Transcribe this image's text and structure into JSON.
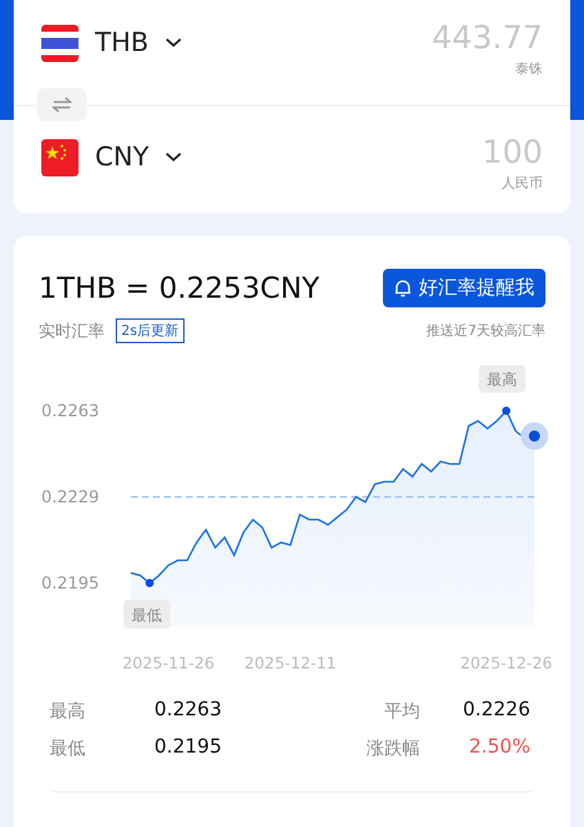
{
  "converter": {
    "rows": [
      {
        "code": "THB",
        "kind": "thailand",
        "amount": "443.77",
        "currency_name": "泰铢"
      },
      {
        "code": "CNY",
        "kind": "china",
        "amount": "100",
        "currency_name": "人民币"
      }
    ]
  },
  "rate": {
    "headline": "1THB = 0.2253CNY",
    "alert_button": "好汇率提醒我",
    "label": "实时汇率",
    "update_badge": "2s后更新",
    "push_note": "推送近7天较高汇率"
  },
  "chart_data": {
    "type": "area",
    "ylim": [
      0.2195,
      0.2263
    ],
    "yticks": [
      0.2195,
      0.2229,
      0.2263
    ],
    "categories": [
      null,
      null,
      null,
      null,
      "2025-11-26",
      null,
      null,
      null,
      null,
      null,
      null,
      null,
      null,
      null,
      null,
      null,
      null,
      "2025-12-11",
      null,
      null,
      null,
      null,
      null,
      null,
      null,
      null,
      null,
      null,
      null,
      null,
      null,
      null,
      null,
      null,
      null,
      null,
      null,
      null,
      null,
      null,
      "2025-12-26",
      null,
      null,
      null
    ],
    "series": [
      {
        "color": "#1a73e8",
        "values": [
          0.2199,
          0.2198,
          0.2195,
          0.2198,
          0.2202,
          0.2204,
          0.2204,
          0.2211,
          0.2216,
          0.2209,
          0.2213,
          0.2206,
          0.2215,
          0.222,
          0.2217,
          0.2209,
          0.2211,
          0.221,
          0.2222,
          0.222,
          0.222,
          0.2218,
          0.2221,
          0.2224,
          0.2229,
          0.2227,
          0.2234,
          0.2235,
          0.2235,
          0.224,
          0.2237,
          0.2242,
          0.2239,
          0.2243,
          0.2242,
          0.2242,
          0.2257,
          0.2259,
          0.2256,
          0.2259,
          0.2263,
          0.2255,
          0.2252,
          0.2253
        ]
      }
    ],
    "annotations": [
      {
        "text": "最高",
        "y": 0.2263
      },
      {
        "text": "最低",
        "y": 0.2195
      }
    ],
    "ref_lines": [
      {
        "axis": "y",
        "value": 0.2229
      }
    ]
  },
  "stats": [
    {
      "label": "最高",
      "value": "0.2263",
      "kind": "plain"
    },
    {
      "label": "平均",
      "value": "0.2226",
      "kind": "plain"
    },
    {
      "label": "最低",
      "value": "0.2195",
      "kind": "plain"
    },
    {
      "label": "涨跌幅",
      "value": "2.50%",
      "kind": "change"
    }
  ]
}
